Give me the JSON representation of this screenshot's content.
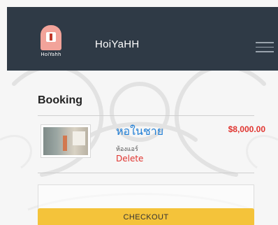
{
  "navbar": {
    "logo_caption": "HoiYahh",
    "brand": "HoiYaHH",
    "menu_icon": "hamburger-icon",
    "bg_color": "#2f3a46"
  },
  "booking": {
    "title": "Booking",
    "items": [
      {
        "name": "หอในชาย",
        "subtitle": "ห้องแอร์",
        "delete_label": "Delete",
        "price": "$8,000.00"
      }
    ]
  },
  "checkout": {
    "label": "CHECKOUT",
    "color": "#f4c33a"
  },
  "colors": {
    "link": "#1f7ed6",
    "danger": "#e0342f"
  }
}
